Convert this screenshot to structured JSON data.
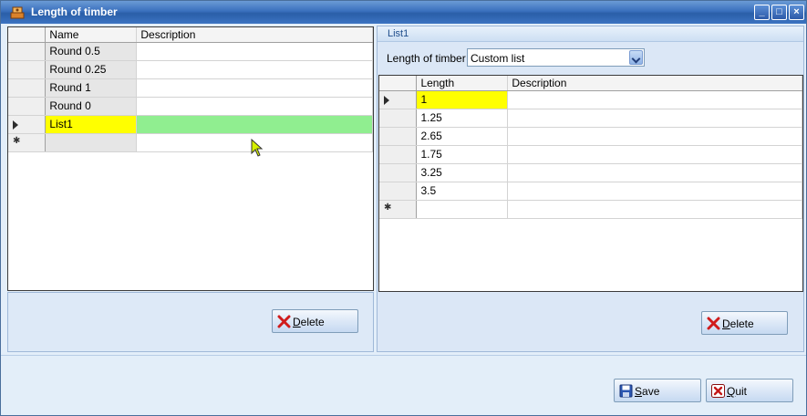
{
  "window": {
    "title": "Length of timber"
  },
  "left_grid": {
    "headers": [
      "Name",
      "Description"
    ],
    "rows": [
      {
        "name": "Round 0.5",
        "description": ""
      },
      {
        "name": "Round 0.25",
        "description": ""
      },
      {
        "name": "Round 1",
        "description": ""
      },
      {
        "name": "Round 0",
        "description": ""
      },
      {
        "name": "List1",
        "description": ""
      }
    ],
    "selected_row": 4
  },
  "left_panel": {
    "delete_label": "Delete"
  },
  "right_panel": {
    "header": "List1",
    "length_label": "Length of timber",
    "length_combo_value": "Custom list",
    "grid": {
      "headers": [
        "Length",
        "Description"
      ],
      "rows": [
        {
          "length": "1",
          "description": ""
        },
        {
          "length": "1.25",
          "description": ""
        },
        {
          "length": "2.65",
          "description": ""
        },
        {
          "length": "1.75",
          "description": ""
        },
        {
          "length": "3.25",
          "description": ""
        },
        {
          "length": "3.5",
          "description": ""
        }
      ]
    },
    "delete_label": "Delete"
  },
  "footer": {
    "save_label": "Save",
    "quit_label": "Quit"
  },
  "icons": {
    "title": "timber-icon",
    "delete": "red-x-icon",
    "save": "floppy-disk-icon",
    "quit": "quit-x-icon"
  }
}
